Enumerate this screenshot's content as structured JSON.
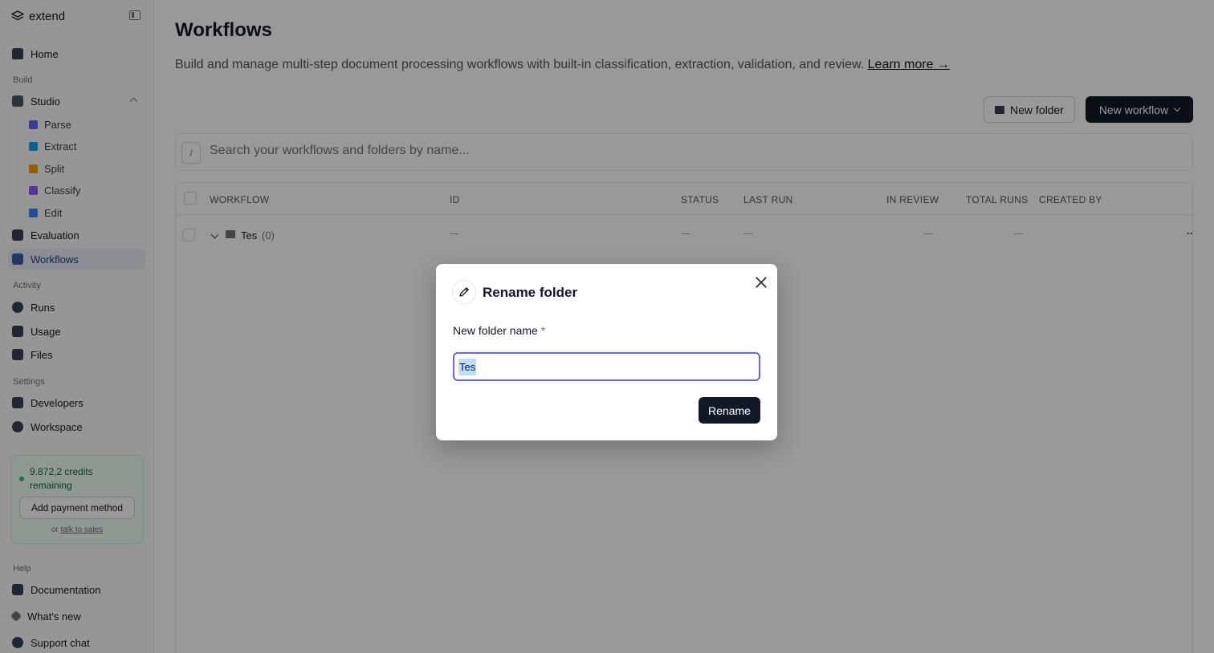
{
  "sidebar": {
    "brand": "extend",
    "items": {
      "home": "Home",
      "build_label": "Build",
      "studio": "Studio",
      "parse": "Parse",
      "extract": "Extract",
      "split": "Split",
      "classify": "Classify",
      "edit": "Edit",
      "evaluation": "Evaluation",
      "workflows": "Workflows",
      "activity_label": "Activity",
      "runs": "Runs",
      "usage": "Usage",
      "files": "Files",
      "settings_label": "Settings",
      "developers": "Developers",
      "workspace": "Workspace",
      "help_label": "Help",
      "documentation": "Documentation",
      "whats_new": "What's new",
      "support_chat": "Support chat"
    },
    "credits": {
      "text": "9.872,2 credits remaining",
      "pay_button": "Add payment method",
      "or": "or",
      "sales_link": "talk to sales"
    }
  },
  "main": {
    "title": "Workflows",
    "description": "Build and manage multi-step document processing workflows with built-in classification, extraction, validation, and review.",
    "learn_more": "Learn more →",
    "new_folder": "New folder",
    "new_workflow": "New workflow",
    "search_slash": "/",
    "search_placeholder": "Search your workflows and folders by name...",
    "columns": {
      "workflow": "WORKFLOW",
      "id": "ID",
      "status": "STATUS",
      "last_run": "LAST RUN",
      "in_review": "IN REVIEW",
      "total_runs": "TOTAL RUNS",
      "created_by": "CREATED BY"
    },
    "rows": [
      {
        "name": "Tes",
        "count": "(0)",
        "more": "··"
      }
    ]
  },
  "modal": {
    "title": "Rename folder",
    "label": "New folder name",
    "required": "*",
    "value": "Tes",
    "submit": "Rename"
  },
  "colors": {
    "primary": "#111827",
    "focus_ring": "#6366f1",
    "credits_green": "#22c55e",
    "active_nav": "#e8edf6"
  }
}
